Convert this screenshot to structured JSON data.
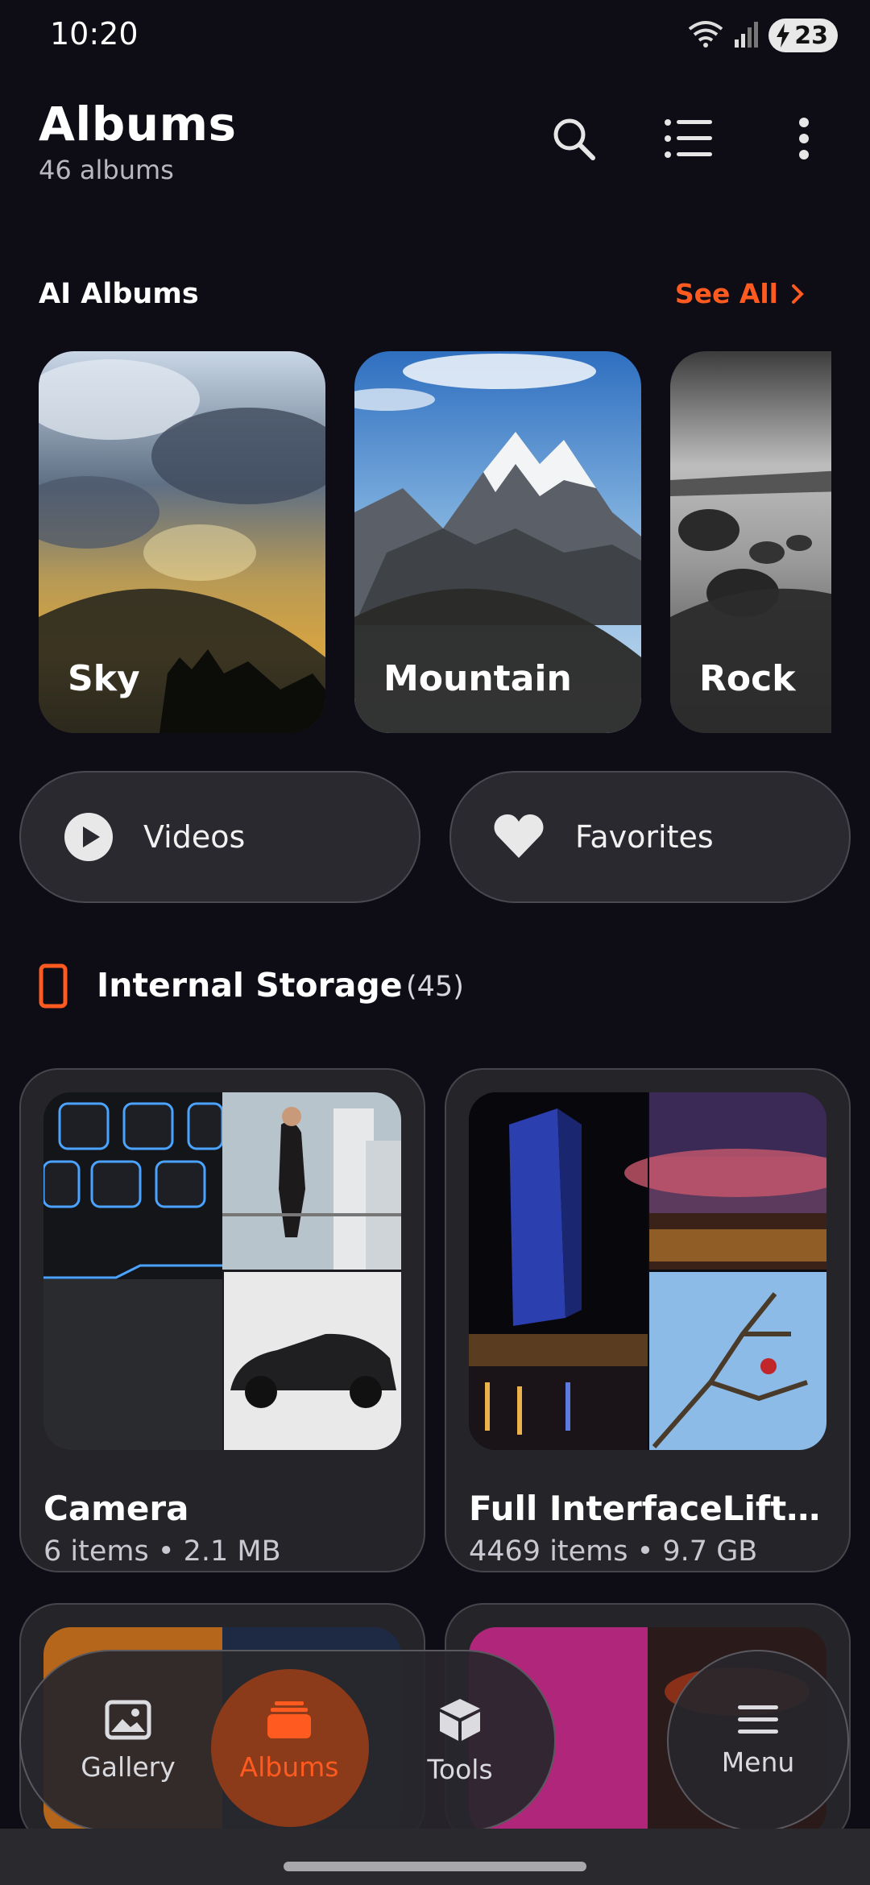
{
  "status_bar": {
    "time": "10:20",
    "battery": "23",
    "icons": [
      "wifi-icon",
      "signal-icon",
      "battery-charging-icon"
    ]
  },
  "header": {
    "title": "Albums",
    "subtitle": "46 albums",
    "icons": [
      "search-icon",
      "list-view-icon",
      "more-vertical-icon"
    ]
  },
  "ai_albums": {
    "title": "AI Albums",
    "see_all": "See All",
    "items": [
      {
        "label": "Sky"
      },
      {
        "label": "Mountain"
      },
      {
        "label": "Rock"
      }
    ]
  },
  "quick_buttons": {
    "videos": "Videos",
    "favorites": "Favorites"
  },
  "storage": {
    "title": "Internal Storage",
    "count": "(45)"
  },
  "albums": [
    {
      "name": "Camera",
      "meta": "6 items • 2.1 MB"
    },
    {
      "name": "Full InterfaceLift.c...",
      "meta": "4469 items • 9.7 GB"
    }
  ],
  "nav": {
    "gallery": "Gallery",
    "albums": "Albums",
    "tools": "Tools",
    "menu": "Menu"
  },
  "colors": {
    "background": "#0e0c15",
    "accent": "#ff5a1f",
    "card": "#252429"
  }
}
